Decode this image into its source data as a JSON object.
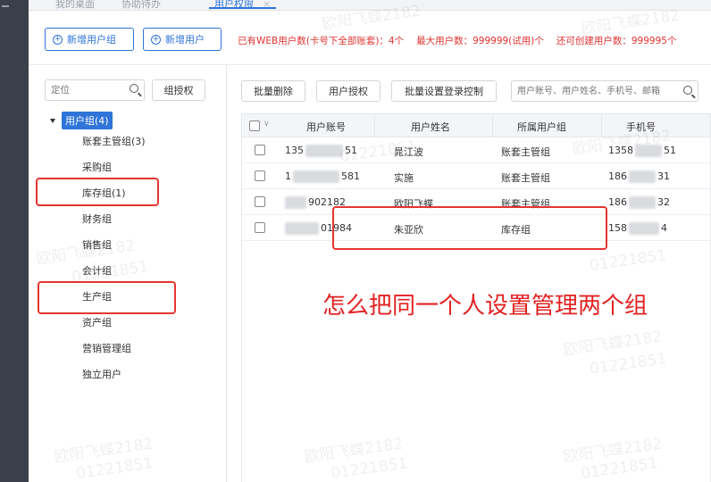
{
  "tabs": [
    {
      "label": "我的桌面"
    },
    {
      "label": "协助待办"
    },
    {
      "label": "用户权限",
      "close": "×"
    }
  ],
  "toolbar": {
    "add_group_label": "新增用户组",
    "add_user_label": "新增用户",
    "quota": {
      "web_users": "已有WEB用户数(卡号下全部账套)：4个",
      "max_users": "最大用户数：999999(试用)个",
      "remaining": "还可创建用户数：999995个"
    }
  },
  "left": {
    "search_placeholder": "定位",
    "group_auth_label": "组授权",
    "tree_root": "用户组(4)",
    "tree_items": [
      "账套主管组(3)",
      "采购组",
      "库存组(1)",
      "财务组",
      "销售组",
      "会计组",
      "生产组",
      "资产组",
      "营销管理组",
      "独立用户"
    ]
  },
  "right": {
    "batch_delete_label": "批量删除",
    "user_auth_label": "用户授权",
    "batch_login_label": "批量设置登录控制",
    "search_placeholder": "用户账号、用户姓名、手机号、邮箱",
    "columns": [
      "用户账号",
      "用户姓名",
      "所属用户组",
      "手机号"
    ],
    "rows": [
      {
        "account_prefix": "135",
        "account_suffix": "51",
        "name": "晁江波",
        "group": "账套主管组",
        "phone_prefix": "1358",
        "phone_suffix": "51"
      },
      {
        "account_prefix": "1",
        "account_suffix": "581",
        "name": "实施",
        "group": "账套主管组",
        "phone_prefix": "186",
        "phone_suffix": "31"
      },
      {
        "account_prefix": "",
        "account_suffix": "902182",
        "name": "欧阳飞蝶",
        "group": "账套主管组",
        "phone_prefix": "186",
        "phone_suffix": "32"
      },
      {
        "account_prefix": "",
        "account_suffix": "01984",
        "name": "朱亚欣",
        "group": "库存组",
        "phone_prefix": "158",
        "phone_suffix": "4"
      }
    ]
  },
  "annotation": {
    "question": "怎么把同一个人设置管理两个组"
  },
  "watermark": {
    "name": "欧阳飞蝶2182",
    "code": "01221851"
  },
  "colors": {
    "accent": "#2f74d8",
    "annotation_red": "#e32222",
    "sidebar_dark": "#3b3f4a"
  }
}
